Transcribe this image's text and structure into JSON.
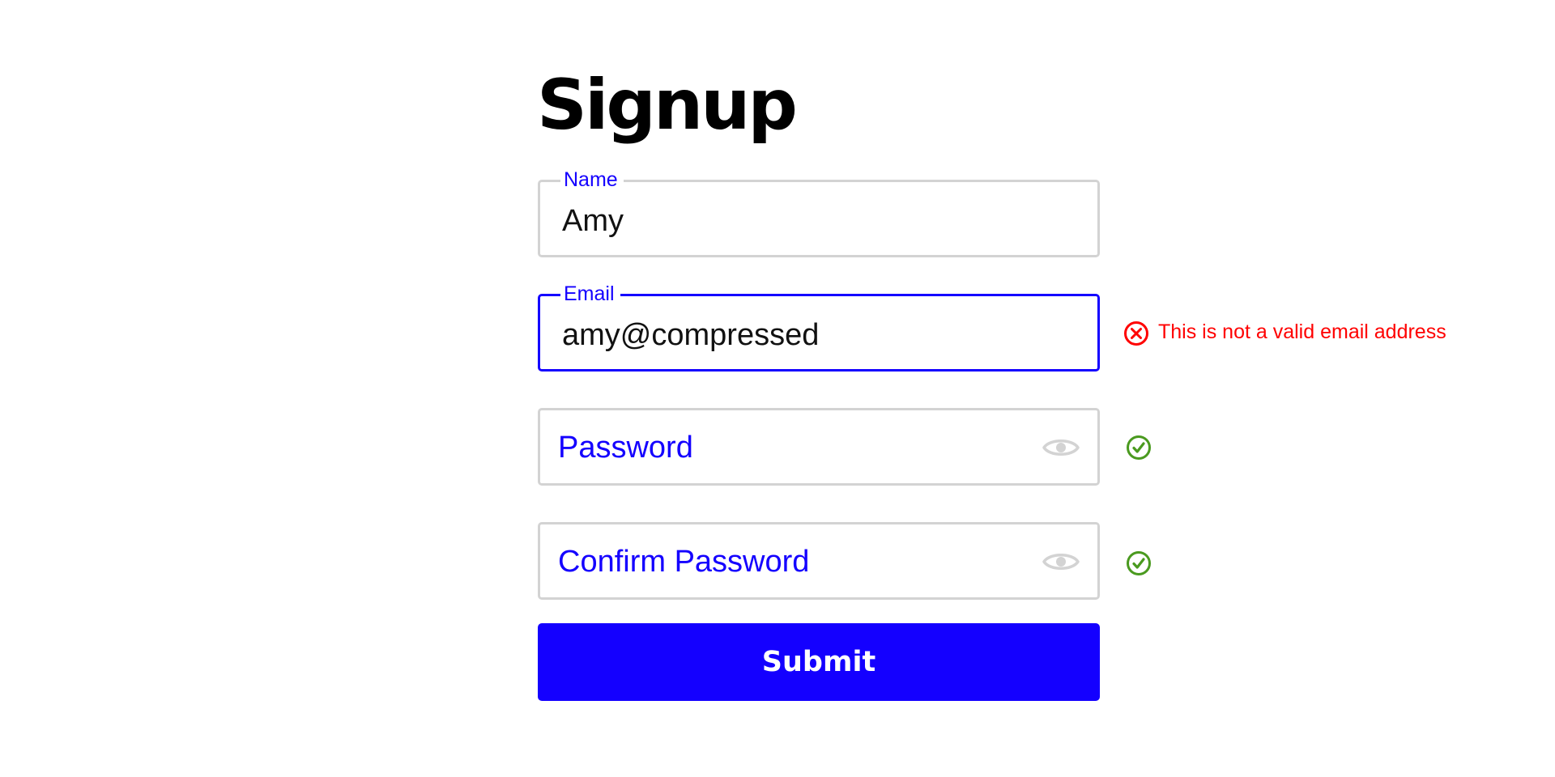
{
  "form": {
    "title": "Signup",
    "fields": {
      "name": {
        "label": "Name",
        "value": "Amy",
        "state": "valid"
      },
      "email": {
        "label": "Email",
        "value": "amy@compressed",
        "state": "error",
        "focused": true,
        "error_message": "This is not a valid email address"
      },
      "password": {
        "placeholder": "Password",
        "value": "",
        "state": "valid",
        "visibility_icon": "eye-icon"
      },
      "confirm_password": {
        "placeholder": "Confirm Password",
        "value": "",
        "state": "valid",
        "visibility_icon": "eye-icon"
      }
    },
    "submit_label": "Submit"
  },
  "colors": {
    "accent": "#1400ff",
    "border": "#d3d3d3",
    "error": "#ff0000",
    "success": "#4a9a1f",
    "text": "#000000",
    "icon_muted": "#d3d3d3"
  },
  "icons": {
    "error": "x-circle-icon",
    "success": "check-circle-icon",
    "visibility": "eye-icon"
  }
}
